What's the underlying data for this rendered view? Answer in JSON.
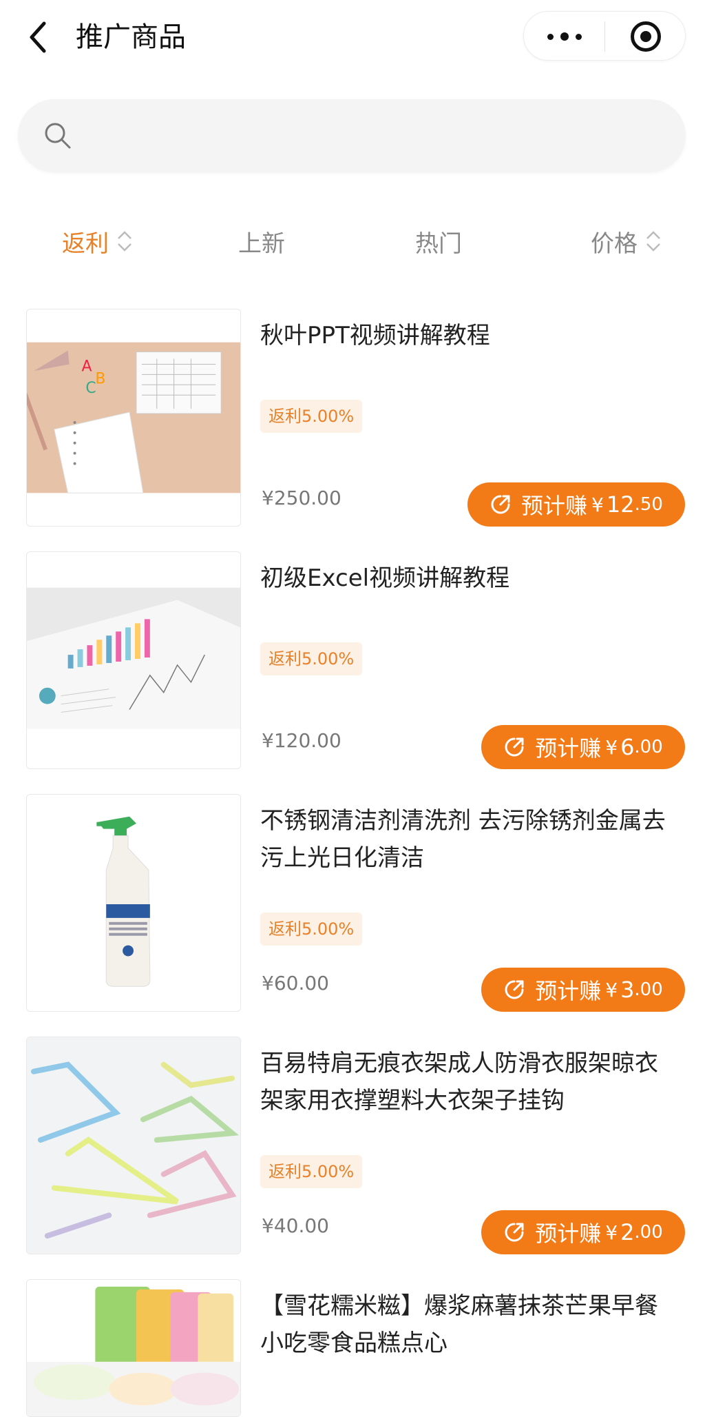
{
  "header": {
    "title": "推广商品"
  },
  "search": {
    "placeholder": ""
  },
  "sort_tabs": [
    {
      "label": "返利",
      "active": true
    },
    {
      "label": "上新",
      "active": false
    },
    {
      "label": "热门",
      "active": false
    },
    {
      "label": "价格",
      "active": false
    }
  ],
  "colors": {
    "accent": "#f27a17",
    "accent_text": "#e8822a",
    "badge_bg": "#fdf1e6"
  },
  "products": [
    {
      "name": "秋叶PPT视频讲解教程",
      "rebate": "返利5.00%",
      "price": "¥250.00",
      "earn_label": "预计赚",
      "earn_currency": "¥",
      "earn_int": "12",
      "earn_dec": ".50",
      "image": "notebook-stationery"
    },
    {
      "name": "初级Excel视频讲解教程",
      "rebate": "返利5.00%",
      "price": "¥120.00",
      "earn_label": "预计赚",
      "earn_currency": "¥",
      "earn_int": "6",
      "earn_dec": ".00",
      "image": "chart-document"
    },
    {
      "name": "不锈钢清洁剂清洗剂 去污除锈剂金属去污上光日化清洁",
      "rebate": "返利5.00%",
      "price": "¥60.00",
      "earn_label": "预计赚",
      "earn_currency": "¥",
      "earn_int": "3",
      "earn_dec": ".00",
      "image": "spray-bottle"
    },
    {
      "name": "百易特肩无痕衣架成人防滑衣服架晾衣架家用衣撑塑料大衣架子挂钩",
      "rebate": "返利5.00%",
      "price": "¥40.00",
      "earn_label": "预计赚",
      "earn_currency": "¥",
      "earn_int": "2",
      "earn_dec": ".00",
      "image": "clothes-hangers"
    },
    {
      "name": "【雪花糯米糍】爆浆麻薯抹茶芒果早餐小吃零食品糕点心",
      "image": "mochi-snacks"
    }
  ]
}
